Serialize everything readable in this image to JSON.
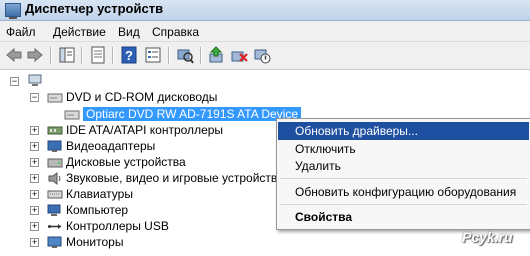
{
  "window": {
    "title": "Диспетчер устройств"
  },
  "menu": {
    "file": "Файл",
    "action": "Действие",
    "view": "Вид",
    "help": "Справка"
  },
  "tree": {
    "dvd_category": "DVD и CD-ROM дисководы",
    "dvd_device": "Optiarc DVD RW AD-7191S ATA Device",
    "categories": [
      "IDE ATA/ATAPI контроллеры",
      "Видеоадаптеры",
      "Дисковые устройства",
      "Звуковые, видео и игровые устройства",
      "Клавиатуры",
      "Компьютер",
      "Контроллеры USB",
      "Мониторы"
    ]
  },
  "context_menu": {
    "update_drivers": "Обновить драйверы...",
    "disable": "Отключить",
    "remove": "Удалить",
    "scan_hardware": "Обновить конфигурацию оборудования",
    "properties": "Свойства"
  },
  "watermark": "Pcyk.ru",
  "colors": {
    "highlight": "#1e4fa0",
    "selection": "#3399ff",
    "menubar": "#f0f0f0"
  }
}
